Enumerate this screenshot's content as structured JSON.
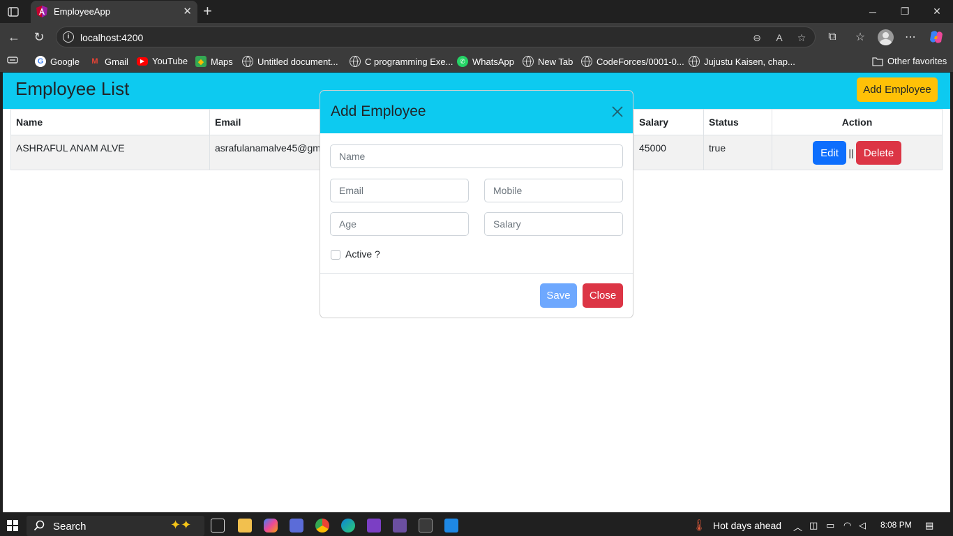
{
  "browser": {
    "tab_title": "EmployeeApp",
    "url": "localhost:4200",
    "bookmarks": [
      {
        "label": "Google",
        "icon": "google-icon"
      },
      {
        "label": "Gmail",
        "icon": "gmail-icon"
      },
      {
        "label": "YouTube",
        "icon": "youtube-icon"
      },
      {
        "label": "Maps",
        "icon": "maps-icon"
      },
      {
        "label": "Untitled document...",
        "icon": "globe-icon"
      },
      {
        "label": "C programming Exe...",
        "icon": "globe-icon"
      },
      {
        "label": "WhatsApp",
        "icon": "whatsapp-icon"
      },
      {
        "label": "New Tab",
        "icon": "globe-icon"
      },
      {
        "label": "CodeForces/0001-0...",
        "icon": "globe-icon"
      },
      {
        "label": "Jujustu Kaisen, chap...",
        "icon": "globe-icon"
      }
    ],
    "other_favorites": "Other favorites"
  },
  "app": {
    "title": "Employee List",
    "add_button": "Add Employee",
    "table": {
      "headers": [
        "Name",
        "Email",
        "Salary",
        "Status",
        "Action"
      ],
      "rows": [
        {
          "name": "ASHRAFUL ANAM ALVE",
          "email": "asrafulanamalve45@gm",
          "salary": "45000",
          "status": "true"
        }
      ],
      "edit_label": "Edit",
      "separator": "||",
      "delete_label": "Delete"
    }
  },
  "modal": {
    "title": "Add Employee",
    "name_placeholder": "Name",
    "email_placeholder": "Email",
    "mobile_placeholder": "Mobile",
    "age_placeholder": "Age",
    "salary_placeholder": "Salary",
    "active_label": "Active ?",
    "save_label": "Save",
    "close_label": "Close"
  },
  "taskbar": {
    "search_label": "Search",
    "weather": "Hot days ahead",
    "time": "8:08 PM"
  },
  "colors": {
    "header": "#0dcaf0",
    "add_button": "#ffc107",
    "edit_button": "#0d6efd",
    "delete_button": "#dc3545",
    "save_button": "#6ea8fe"
  }
}
